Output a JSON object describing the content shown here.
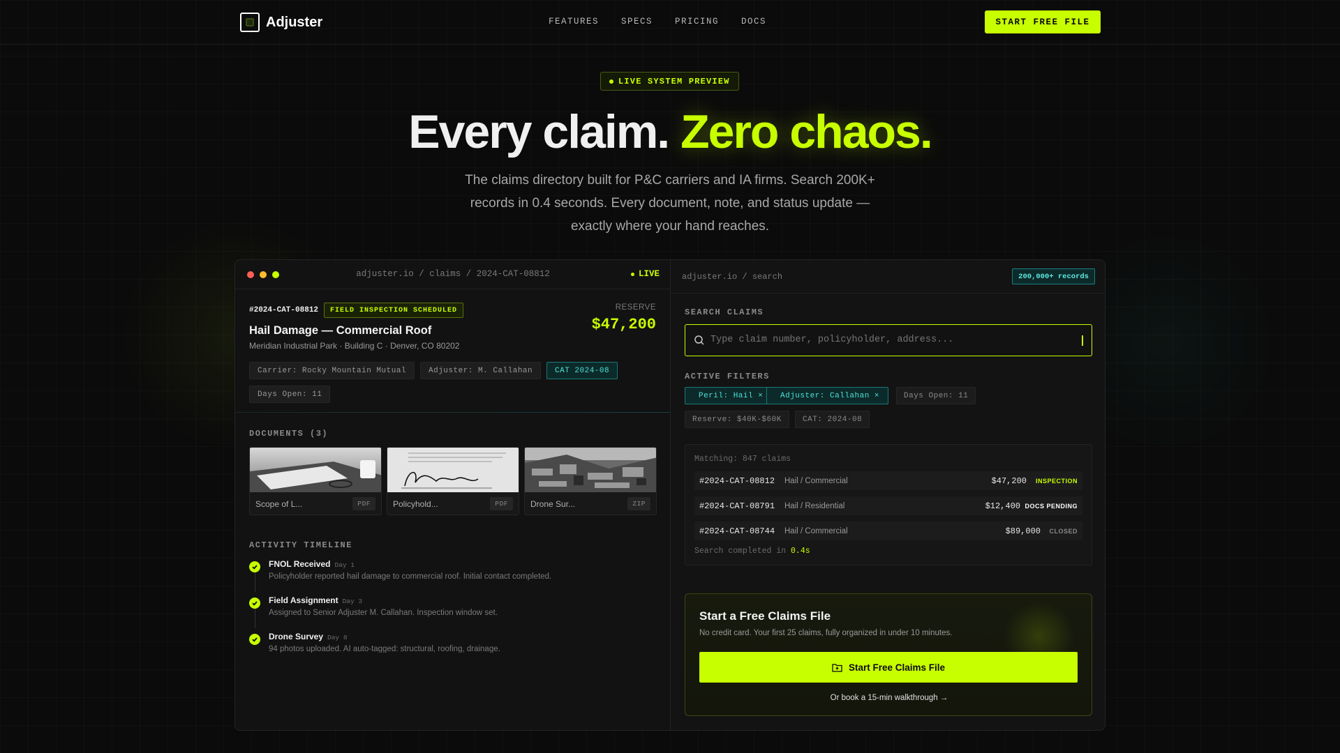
{
  "brand": {
    "name": "Adjuster"
  },
  "nav": {
    "links": [
      "FEATURES",
      "SPECS",
      "PRICING",
      "DOCS"
    ],
    "cta": "START FREE FILE"
  },
  "hero": {
    "badge": "LIVE SYSTEM PREVIEW",
    "title_main": "Every claim.",
    "title_accent": "Zero chaos.",
    "subtitle": "The claims directory built for P&C carriers and IA firms. Search 200K+ records in 0.4 seconds. Every document, note, and status update — exactly where your hand reaches."
  },
  "claim_window": {
    "path": "adjuster.io / claims / 2024-CAT-08812",
    "live_label": "LIVE",
    "claim_id": "#2024-CAT-08812",
    "status": "FIELD INSPECTION SCHEDULED",
    "title": "Hail Damage — Commercial Roof",
    "location": "Meridian Industrial Park · Building C · Denver, CO 80202",
    "reserve_label": "RESERVE",
    "reserve_value": "$47,200",
    "tags": [
      "Carrier: Rocky Mountain Mutual",
      "Adjuster: M. Callahan",
      "CAT 2024-08",
      "Days Open: 11"
    ],
    "documents_label": "DOCUMENTS (3)",
    "documents": [
      {
        "name": "Scope of L...",
        "type": "PDF"
      },
      {
        "name": "Policyhold...",
        "type": "PDF"
      },
      {
        "name": "Drone Sur...",
        "type": "ZIP"
      }
    ],
    "timeline_label": "ACTIVITY TIMELINE",
    "timeline": [
      {
        "title": "FNOL Received",
        "day": "Day 1",
        "desc": "Policyholder reported hail damage to commercial roof. Initial contact completed."
      },
      {
        "title": "Field Assignment",
        "day": "Day 3",
        "desc": "Assigned to Senior Adjuster M. Callahan. Inspection window set."
      },
      {
        "title": "Drone Survey",
        "day": "Day 8",
        "desc": "94 photos uploaded. AI auto-tagged: structural, roofing, drainage."
      }
    ]
  },
  "search_window": {
    "path": "adjuster.io / search",
    "records_badge": "200,000+ records",
    "search_label": "SEARCH CLAIMS",
    "search_placeholder": "Type claim number, policyholder, address...",
    "filters_label": "ACTIVE FILTERS",
    "filters": [
      {
        "label": "Peril: Hail ×",
        "active": true
      },
      {
        "label": "Adjuster: Callahan ×",
        "active": true
      },
      {
        "label": "Days Open: 11",
        "active": false
      },
      {
        "label": "Reserve: $40K-$60K",
        "active": false
      },
      {
        "label": "CAT: 2024-08",
        "active": false
      }
    ],
    "matching": "Matching: 847 claims",
    "results": [
      {
        "id": "#2024-CAT-08812",
        "type": "Hail / Commercial",
        "amount": "$47,200",
        "status": "INSPECTION",
        "status_color": "#c8ff00"
      },
      {
        "id": "#2024-CAT-08791",
        "type": "Hail / Residential",
        "amount": "$12,400",
        "status": "DOCS PENDING",
        "status_color": "#ffffff"
      },
      {
        "id": "#2024-CAT-08744",
        "type": "Hail / Commercial",
        "amount": "$89,000",
        "status": "CLOSED",
        "status_color": "#8a8a8a"
      }
    ],
    "footer_prefix": "Search completed in",
    "footer_time": "0.4s",
    "cta": {
      "title": "Start a Free Claims File",
      "subtitle": "No credit card. Your first 25 claims, fully organized in under 10 minutes.",
      "button": "Start Free Claims File",
      "link": "Or book a 15-min walkthrough →"
    }
  },
  "colors": {
    "accent": "#c8ff00",
    "teal": "#4ee0d8",
    "background": "#0b0b0b"
  }
}
